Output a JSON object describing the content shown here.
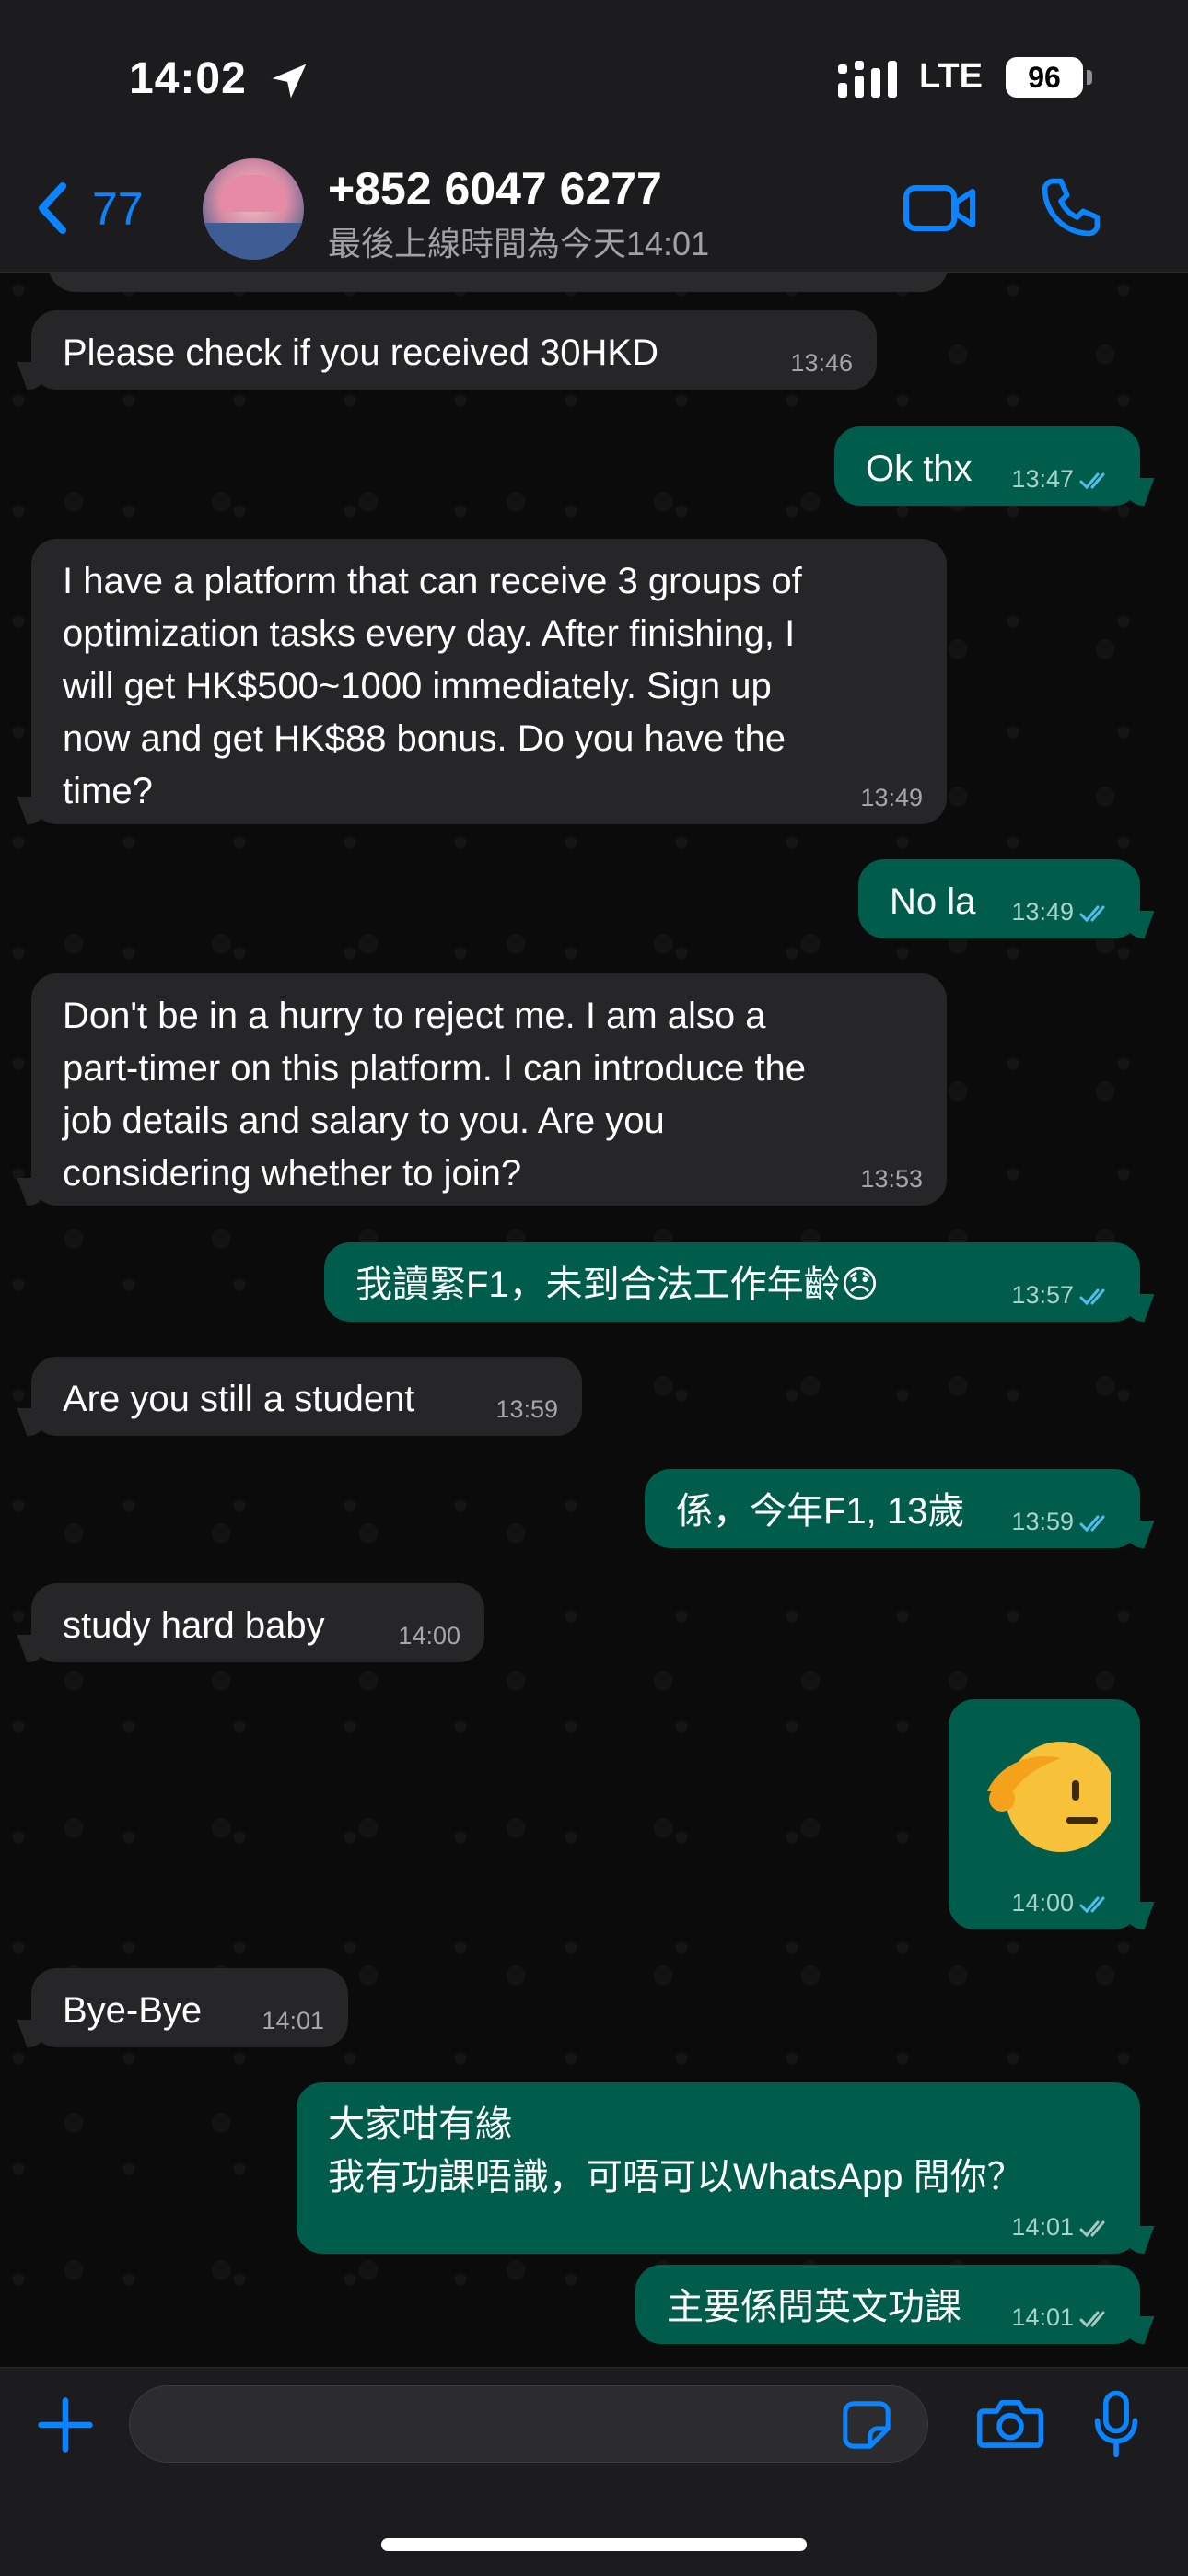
{
  "status_bar": {
    "time": "14:02",
    "network": "LTE",
    "battery": "96"
  },
  "header": {
    "back_count": "77",
    "contact_name": "+852 6047 6277",
    "last_seen": "最後上線時間為今天14:01"
  },
  "messages": [
    {
      "dir": "in",
      "text": "Please check if you received 30HKD",
      "time": "13:46"
    },
    {
      "dir": "out",
      "text": "Ok thx",
      "time": "13:47",
      "status": "read"
    },
    {
      "dir": "in",
      "text": "I have a platform that can receive 3 groups of\noptimization tasks every day. After finishing, I\nwill get HK$500~1000 immediately. Sign up\nnow and get HK$88 bonus. Do you have the\ntime?",
      "time": "13:49"
    },
    {
      "dir": "out",
      "text": "No la",
      "time": "13:49",
      "status": "read"
    },
    {
      "dir": "in",
      "text": "Don't be in a hurry to reject me. I am also a\npart-timer on this platform. I can introduce the\njob details and salary to you. Are you\nconsidering whether to join?",
      "time": "13:53"
    },
    {
      "dir": "out",
      "text": "我讀緊F1，未到合法工作年齡😞",
      "time": "13:57",
      "status": "read"
    },
    {
      "dir": "in",
      "text": "Are you still a student",
      "time": "13:59"
    },
    {
      "dir": "out",
      "text": "係，今年F1, 13歲",
      "time": "13:59",
      "status": "read"
    },
    {
      "dir": "in",
      "text": "study hard baby",
      "time": "14:00"
    },
    {
      "dir": "out",
      "text": "",
      "emoji": "saluting-face",
      "time": "14:00",
      "status": "read"
    },
    {
      "dir": "in",
      "text": "Bye-Bye",
      "time": "14:01"
    },
    {
      "dir": "out",
      "text": "大家咁有緣\n我有功課唔識，可唔可以WhatsApp 問你？",
      "time": "14:01",
      "status": "delivered"
    },
    {
      "dir": "out",
      "text": "主要係問英文功課",
      "time": "14:01",
      "status": "delivered"
    }
  ],
  "input": {
    "placeholder": "",
    "value": ""
  },
  "colors": {
    "accent": "#0a84ff",
    "outgoing_bubble": "#005c4b",
    "incoming_bubble": "#262628",
    "read_tick": "#53bdeb"
  },
  "icons": [
    "location-arrow-icon",
    "signal-icon",
    "back-chevron-icon",
    "video-call-icon",
    "phone-call-icon",
    "plus-icon",
    "sticker-icon",
    "camera-icon",
    "mic-icon"
  ]
}
